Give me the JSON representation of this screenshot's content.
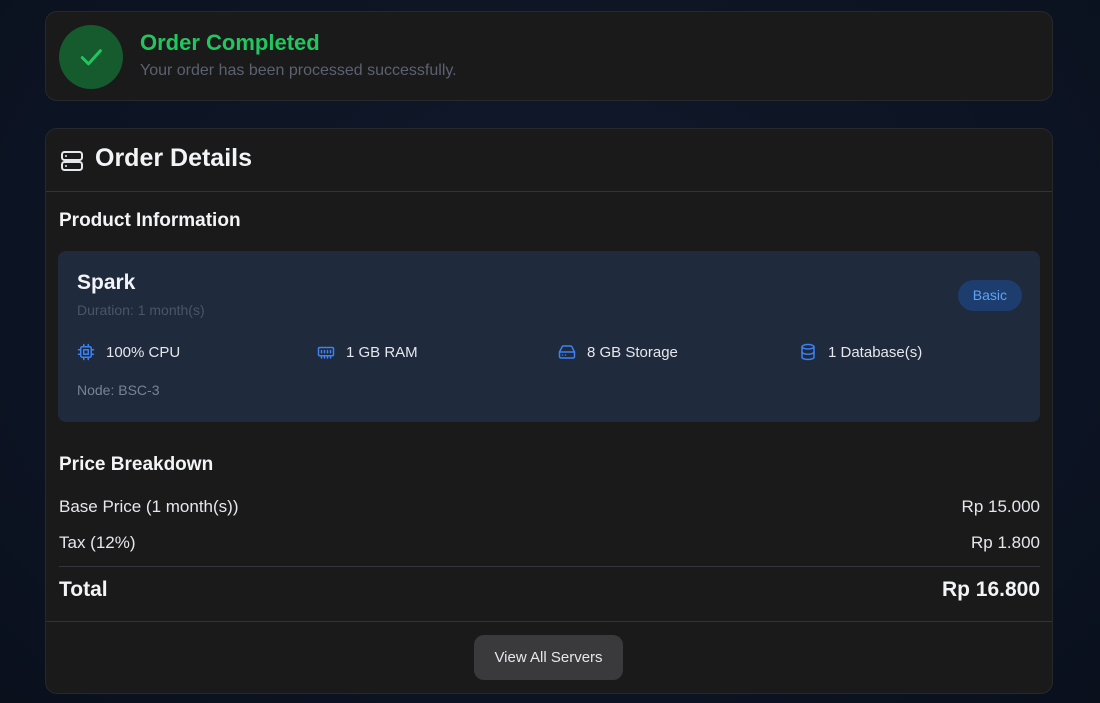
{
  "status": {
    "title": "Order Completed",
    "subtitle": "Your order has been processed successfully.",
    "icon": "check-icon",
    "color": "#22c55e"
  },
  "details": {
    "title": "Order Details",
    "icon": "server-icon",
    "product_section_title": "Product Information",
    "product": {
      "name": "Spark",
      "duration": "Duration: 1 month(s)",
      "badge": "Basic",
      "specs": [
        {
          "icon": "cpu-icon",
          "label": "100% CPU"
        },
        {
          "icon": "memory-icon",
          "label": "1 GB RAM"
        },
        {
          "icon": "hard-drive-icon",
          "label": "8 GB Storage"
        },
        {
          "icon": "database-icon",
          "label": "1 Database(s)"
        }
      ],
      "node": "Node: BSC-3"
    },
    "price_section_title": "Price Breakdown",
    "prices": [
      {
        "label": "Base Price (1 month(s))",
        "value": "Rp 15.000"
      },
      {
        "label": "Tax (12%)",
        "value": "Rp 1.800"
      }
    ],
    "total": {
      "label": "Total",
      "value": "Rp 16.800"
    },
    "button_label": "View All Servers"
  },
  "colors": {
    "accent_blue": "#3b82f6",
    "success_green": "#22c55e"
  }
}
